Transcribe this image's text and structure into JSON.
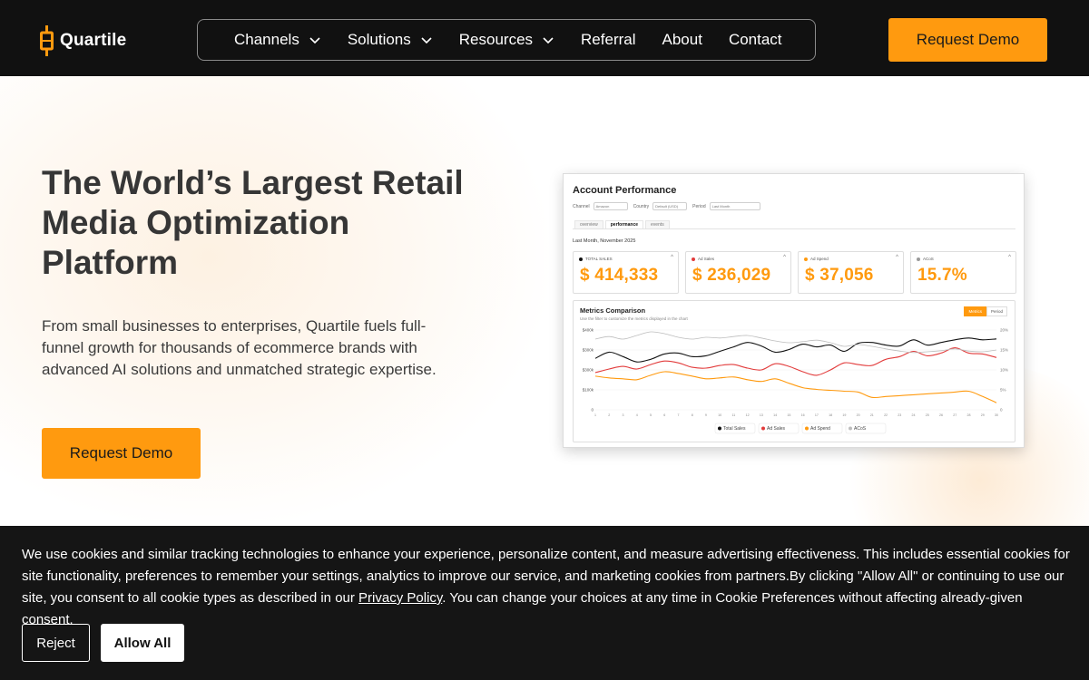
{
  "header": {
    "logo_text": "Quartile",
    "nav": [
      {
        "label": "Channels",
        "has_dropdown": true
      },
      {
        "label": "Solutions",
        "has_dropdown": true
      },
      {
        "label": "Resources",
        "has_dropdown": true
      },
      {
        "label": "Referral",
        "has_dropdown": false
      },
      {
        "label": "About",
        "has_dropdown": false
      },
      {
        "label": "Contact",
        "has_dropdown": false
      }
    ],
    "cta_label": "Request Demo"
  },
  "hero": {
    "title": "The World’s Largest Retail Media Optimization Platform",
    "subtitle": "From small businesses to enterprises, Quartile fuels full-funnel growth for thousands of ecommerce brands with advanced AI solutions and unmatched strategic expertise.",
    "cta_label": "Request Demo"
  },
  "dashboard": {
    "title": "Account Performance",
    "filters": [
      {
        "label": "Channel",
        "value": "Amazon"
      },
      {
        "label": "Country",
        "value": "Default (USD)"
      },
      {
        "label": "Period",
        "value": "Last Month"
      }
    ],
    "tabs": [
      "overview",
      "performance",
      "events"
    ],
    "active_tab": "performance",
    "period_label": "Last Month, November 2025",
    "kpis": [
      {
        "label": "TOTAL SALES",
        "value": "$ 414,333",
        "color": "#111111"
      },
      {
        "label": "Ad Sales",
        "value": "$ 236,029",
        "color": "#e23b3b"
      },
      {
        "label": "Ad Spend",
        "value": "$ 37,056",
        "color": "#ff9a0f"
      },
      {
        "label": "ACoS",
        "value": "15.7%",
        "color": "#9a9a9a"
      }
    ],
    "metrics": {
      "title": "Metrics Comparison",
      "subtitle": "Use the filter to customize the metrics displayed in the chart",
      "toggle": [
        "Metrics",
        "Period"
      ],
      "toggle_active": "Metrics"
    }
  },
  "chart_data": {
    "type": "line",
    "x": [
      1,
      2,
      3,
      4,
      5,
      6,
      7,
      8,
      9,
      10,
      11,
      12,
      13,
      14,
      15,
      16,
      17,
      18,
      19,
      20,
      21,
      22,
      23,
      24,
      25,
      26,
      27,
      28,
      29,
      30
    ],
    "y_left_ticks": [
      "$400k",
      "$300k",
      "$300k",
      "$100k",
      "0"
    ],
    "y_right_ticks": [
      "20%",
      "15%",
      "10%",
      "5%",
      "0"
    ],
    "ylim_left": [
      0,
      450000
    ],
    "ylim_right": [
      0,
      22
    ],
    "series": [
      {
        "name": "Total Sales",
        "axis": "left",
        "color": "#111111",
        "values": [
          290000,
          325000,
          300000,
          270000,
          285000,
          315000,
          320000,
          300000,
          305000,
          330000,
          355000,
          380000,
          360000,
          325000,
          340000,
          370000,
          355000,
          365000,
          330000,
          375000,
          380000,
          365000,
          360000,
          395000,
          365000,
          380000,
          395000,
          405000,
          395000,
          400000
        ]
      },
      {
        "name": "Ad Sales",
        "axis": "left",
        "color": "#e23b3b",
        "values": [
          210000,
          230000,
          245000,
          230000,
          255000,
          275000,
          265000,
          240000,
          235000,
          250000,
          255000,
          235000,
          225000,
          260000,
          245000,
          215000,
          195000,
          225000,
          265000,
          255000,
          250000,
          285000,
          300000,
          330000,
          305000,
          320000,
          350000,
          320000,
          315000,
          295000
        ]
      },
      {
        "name": "Ad Spend",
        "axis": "left",
        "color": "#ff9a0f",
        "values": [
          190000,
          180000,
          175000,
          170000,
          195000,
          215000,
          205000,
          190000,
          175000,
          180000,
          185000,
          170000,
          160000,
          175000,
          150000,
          125000,
          115000,
          110000,
          105000,
          100000,
          70000,
          75000,
          80000,
          85000,
          90000,
          95000,
          100000,
          105000,
          75000,
          40000
        ]
      },
      {
        "name": "ACoS",
        "axis": "right",
        "color": "#bdbdbd",
        "values": [
          19.5,
          20.2,
          19.5,
          20.5,
          21.5,
          21,
          20,
          19.5,
          20,
          19.8,
          20.2,
          20.5,
          19.8,
          19,
          18.5,
          18.8,
          19.2,
          18.5,
          17.5,
          18,
          17.5,
          16.8,
          16.2,
          15.8,
          16,
          16.3,
          16.8,
          16.2,
          16,
          16.5
        ]
      }
    ],
    "legend": [
      "Total Sales",
      "Ad Sales",
      "Ad Spend",
      "ACoS"
    ],
    "legend_position": "bottom"
  },
  "cookie": {
    "text_before": "We use cookies and similar tracking technologies to enhance your experience, personalize content, and measure advertising effectiveness. This includes essential cookies for site functionality, preferences to remember your settings, analytics to improve our service, and marketing cookies from partners.By clicking \"Allow All\" or continuing to use our site, you consent to all cookie types as described in our ",
    "link_text": "Privacy Policy",
    "text_after": ". You can change your choices at any time in Cookie Preferences without affecting already-given consent.",
    "reject_label": "Reject",
    "allow_label": "Allow All"
  },
  "colors": {
    "accent": "#ff9a0f",
    "header_bg": "#111111",
    "cookie_bg": "#151515"
  },
  "icons": {
    "logo": "quartile-logo-icon",
    "dropdown": "chevron-down-icon"
  }
}
